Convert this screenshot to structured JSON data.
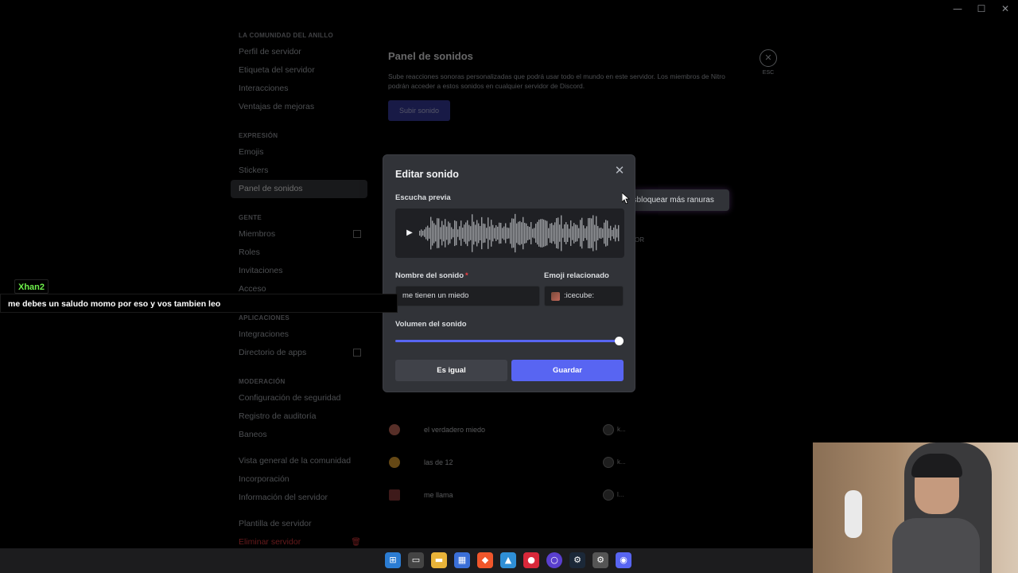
{
  "window_controls": {
    "minimize": "—",
    "maximize": "☐",
    "close": "✕"
  },
  "sidebar": {
    "sections": [
      {
        "title": "LA COMUNIDAD DEL ANILLO",
        "items": [
          "Perfil de servidor",
          "Etiqueta del servidor",
          "Interacciones",
          "Ventajas de mejoras"
        ]
      },
      {
        "title": "EXPRESIÓN",
        "items": [
          "Emojis",
          "Stickers",
          "Panel de sonidos"
        ]
      },
      {
        "title": "GENTE",
        "items": [
          "Miembros",
          "Roles",
          "Invitaciones",
          "Acceso"
        ]
      },
      {
        "title": "APLICACIONES",
        "items": [
          "Integraciones",
          "Directorio de apps"
        ]
      },
      {
        "title": "MODERACIÓN",
        "items": [
          "Configuración de seguridad",
          "Registro de auditoría",
          "Baneos"
        ]
      }
    ],
    "extra_items": [
      "Vista general de la comunidad",
      "Incorporación",
      "Información del servidor"
    ],
    "template_item": "Plantilla de servidor",
    "delete_item": "Eliminar servidor",
    "active": "Panel de sonidos"
  },
  "main": {
    "title": "Panel de sonidos",
    "description": "Sube reacciones sonoras personalizadas que podrá usar todo el mundo en este servidor. Los miembros de Nitro podrán acceder a estos sonidos en cualquier servidor de Discord.",
    "upload_button": "Subir sonido",
    "esc_label": "ESC",
    "unlock_button": "esbloquear más ranuras",
    "column_header": "OR",
    "sounds": [
      {
        "name": "el verdadero miedo",
        "user": "k...",
        "emoji_color": "#c0685a"
      },
      {
        "name": "las de 12",
        "user": "k...",
        "emoji_color": "#e0a030"
      },
      {
        "name": "me llama",
        "user": "l...",
        "emoji_color": "#8a3a3a"
      }
    ]
  },
  "modal": {
    "title": "Editar sonido",
    "preview_label": "Escucha previa",
    "name_label": "Nombre del sonido",
    "required_mark": "*",
    "name_value": "me tienen un miedo",
    "emoji_label": "Emoji relacionado",
    "emoji_value": ":icecube:",
    "volume_label": "Volumen del sonido",
    "volume_value": 1.0,
    "cancel_button": "Es igual",
    "save_button": "Guardar"
  },
  "chat": {
    "username": "Xhan2",
    "message": "me debes un saludo momo por eso y vos tambien leo",
    "username_color": "#6ef04b"
  },
  "taskbar": {
    "icons": [
      "windows-start",
      "task-view",
      "file-explorer",
      "store",
      "brave",
      "photos",
      "app-red",
      "app-circle",
      "steam",
      "settings",
      "discord"
    ]
  },
  "colors": {
    "accent": "#5865f2",
    "danger": "#f23f43",
    "modal_bg": "#313338"
  }
}
